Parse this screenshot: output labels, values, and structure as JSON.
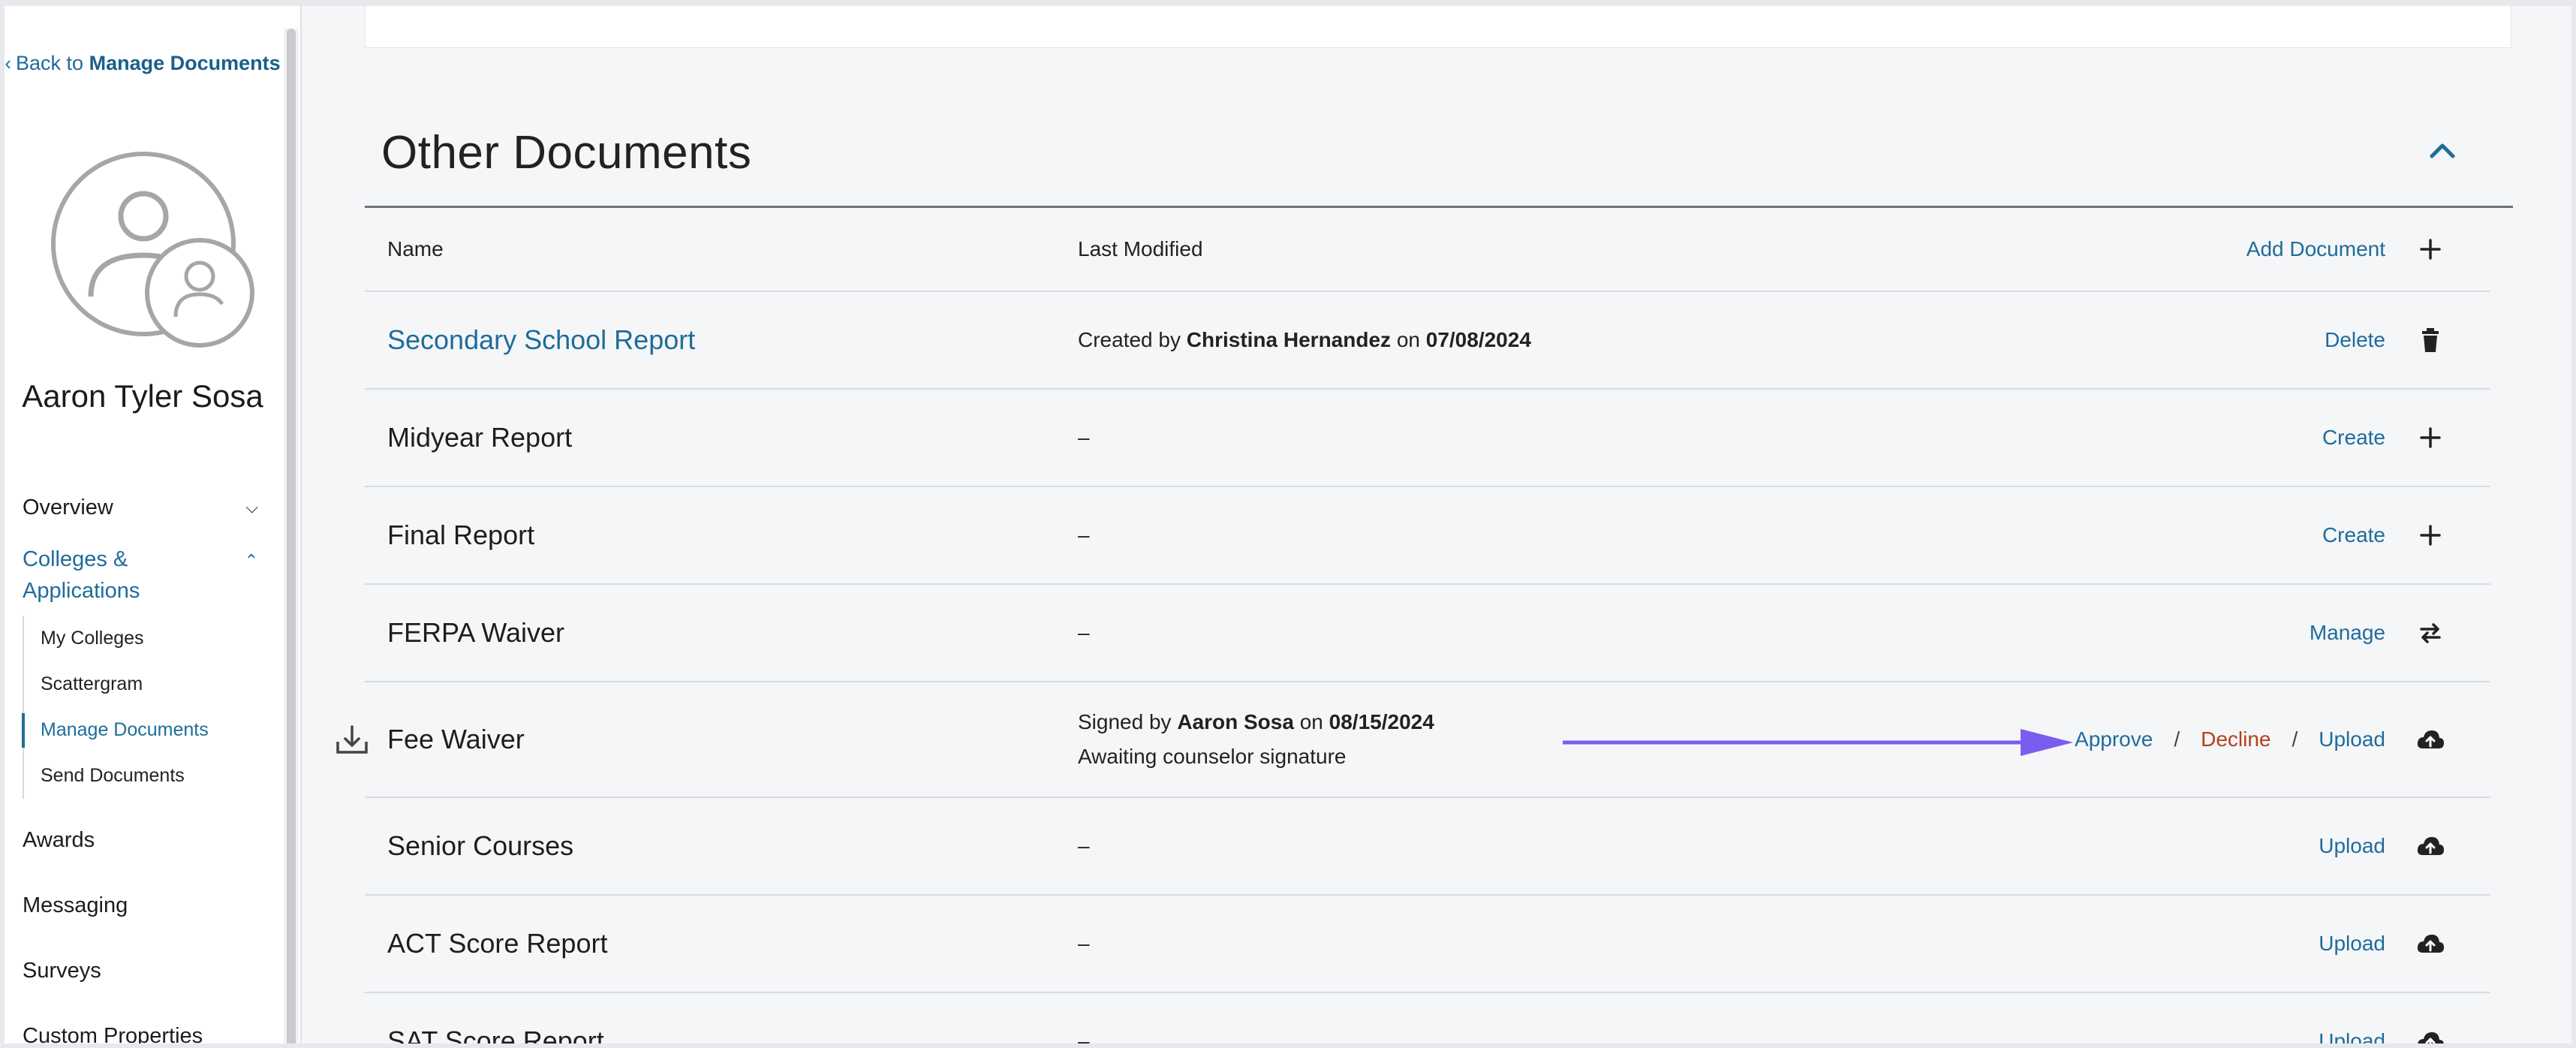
{
  "sidebar": {
    "back_prefix": "Back to",
    "back_target": "Manage Documents",
    "student_name": "Aaron Tyler Sosa",
    "nav": {
      "overview": "Overview",
      "colleges": "Colleges & Applications",
      "sub": {
        "my_colleges": "My Colleges",
        "scattergram": "Scattergram",
        "manage_documents": "Manage Documents",
        "send_documents": "Send Documents"
      },
      "awards": "Awards",
      "messaging": "Messaging",
      "surveys": "Surveys",
      "custom_properties": "Custom Properties"
    }
  },
  "main": {
    "section_title": "Other Documents",
    "header": {
      "name": "Name",
      "last_modified": "Last Modified",
      "add_document": "Add Document"
    },
    "rows": [
      {
        "name": "Secondary School Report",
        "mod_prefix": "Created by",
        "mod_person": "Christina Hernandez",
        "mod_mid": "on",
        "mod_date": "07/08/2024",
        "action": "Delete",
        "icon": "trash-icon"
      },
      {
        "name": "Midyear Report",
        "mod": "–",
        "action": "Create",
        "icon": "plus-icon"
      },
      {
        "name": "Final Report",
        "mod": "–",
        "action": "Create",
        "icon": "plus-icon"
      },
      {
        "name": "FERPA Waiver",
        "mod": "–",
        "action": "Manage",
        "icon": "swap-icon"
      },
      {
        "name": "Fee Waiver",
        "mod_prefix": "Signed by",
        "mod_person": "Aaron Sosa",
        "mod_mid": "on",
        "mod_date": "08/15/2024",
        "mod_line2": "Awaiting counselor signature",
        "approve": "Approve",
        "decline": "Decline",
        "upload": "Upload",
        "sep": "/",
        "icon": "cloud-upload-icon"
      },
      {
        "name": "Senior Courses",
        "mod": "–",
        "action": "Upload",
        "icon": "cloud-upload-icon"
      },
      {
        "name": "ACT Score Report",
        "mod": "–",
        "action": "Upload",
        "icon": "cloud-upload-icon"
      },
      {
        "name": "SAT Score Report",
        "mod": "–",
        "action": "Upload",
        "icon": "cloud-upload-icon"
      }
    ],
    "annotation_color": "#7b5cf0",
    "link_color": "#1f6c9a",
    "decline_color": "#b4411b"
  }
}
